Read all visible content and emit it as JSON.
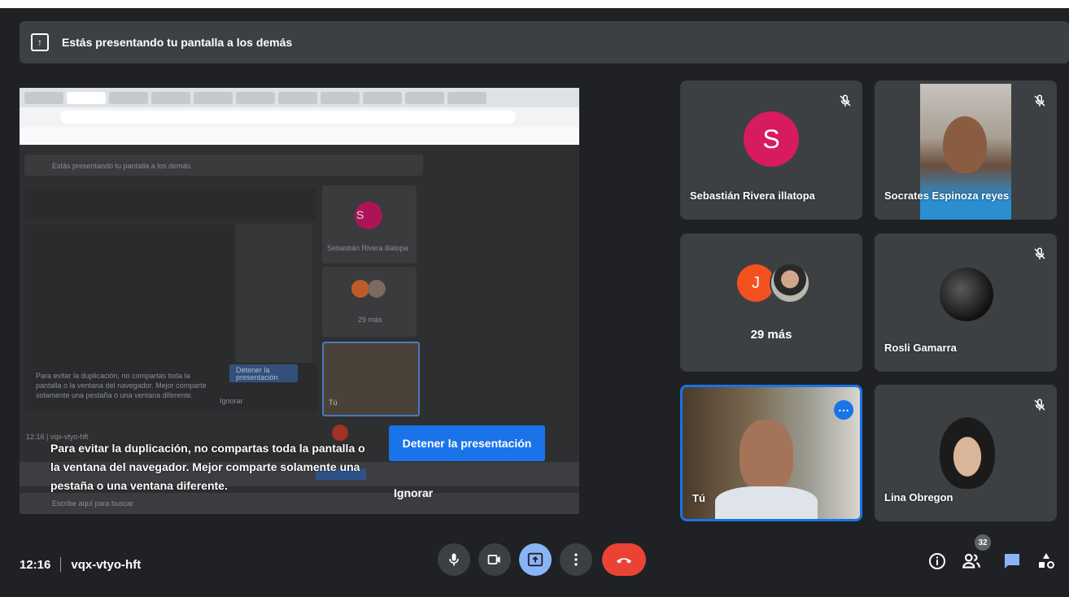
{
  "banner": {
    "text": "Estás presentando tu pantalla a los demás",
    "icon": "present-screen-icon"
  },
  "preview": {
    "banner_text": "Estás presentando tu pantalla a los demás",
    "tile1_letter": "S",
    "tile1_name": "Sebastián Rivera illatopa",
    "more_label": "29 más",
    "you_label": "Tú",
    "msg": "Para evitar la duplicación, no compartas toda la pantalla o la ventana del navegador. Mejor comparte solamente una pestaña o una ventana diferente.",
    "stop_label": "Detener la presentación",
    "ignore_label": "Ignorar",
    "bottom_label": "12:16 | vqx-vtyo-hft",
    "taskbar_search": "Escribe aquí para buscar"
  },
  "overlay": {
    "message": "Para evitar la duplicación, no compartas toda la pantalla o la ventana del navegador. Mejor comparte solamente una pestaña o una ventana diferente.",
    "stop_button": "Detener la presentación",
    "ignore_button": "Ignorar"
  },
  "participants": {
    "sebastian": {
      "letter": "S",
      "name": "Sebastián Rivera illatopa",
      "color": "#d81b60",
      "muted": true
    },
    "socrates": {
      "name": "Socrates Espinoza reyes",
      "muted": true
    },
    "more": {
      "letter": "J",
      "color": "#f4511e",
      "label": "29 más"
    },
    "rosli": {
      "name": "Rosli Gamarra",
      "muted": true
    },
    "you": {
      "name": "Tú"
    },
    "lina": {
      "name": "Lina Obregon",
      "muted": true
    }
  },
  "meeting": {
    "time": "12:16",
    "code": "vqx-vtyo-hft"
  },
  "controls": {
    "mic": "microphone-icon",
    "camera": "camera-icon",
    "present": "present-screen-icon",
    "more": "more-vert-icon",
    "leave": "end-call-icon"
  },
  "right_controls": {
    "people_count": "32"
  },
  "colors": {
    "accent": "#1a73e8",
    "leave": "#ea4335",
    "present_active": "#8ab4f8"
  }
}
